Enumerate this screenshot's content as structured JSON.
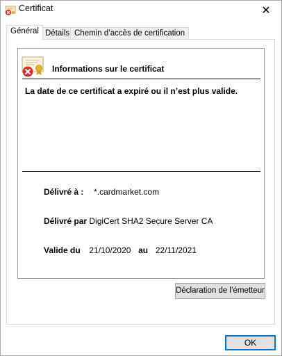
{
  "window": {
    "title": "Certificat",
    "close_symbol": "✕"
  },
  "tabs": [
    {
      "label": "Général",
      "active": true
    },
    {
      "label": "Détails",
      "active": false
    },
    {
      "label": "Chemin d’accès de certification",
      "active": false
    }
  ],
  "general": {
    "section_title": "Informations sur le certificat",
    "status_message": "La date de ce certificat a expiré ou il n’est plus valide.",
    "issued_to_label": "Délivré à :",
    "issued_to_value": "*.cardmarket.com",
    "issued_by_label": "Délivré par",
    "issued_by_value": "DigiCert SHA2 Secure Server CA",
    "valid_from_label": "Valide du",
    "valid_from_value": "21/10/2020",
    "valid_to_label": "au",
    "valid_to_value": "22/11/2021",
    "issuer_statement_button": "Déclaration de l’émetteur"
  },
  "footer": {
    "ok_button": "OK"
  },
  "icons": {
    "title_icon": "certificate-error-icon",
    "cert_icon": "certificate-expired-icon"
  }
}
